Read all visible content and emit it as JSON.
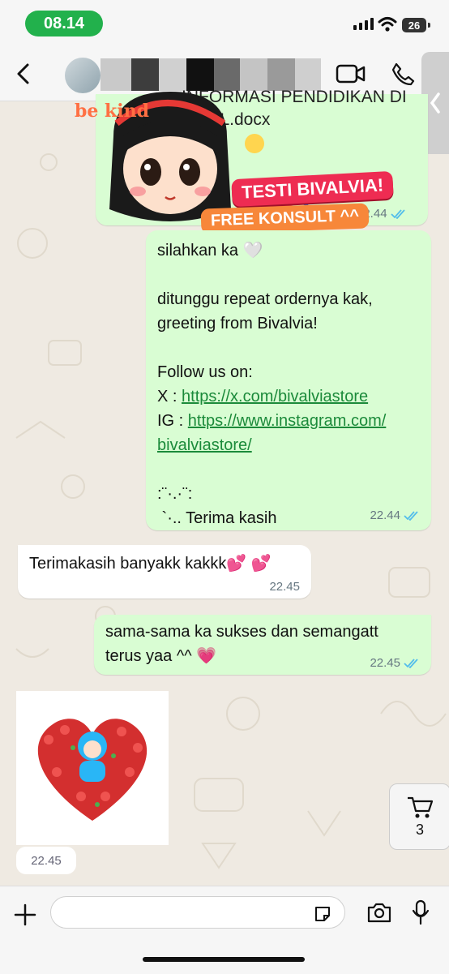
{
  "status_bar": {
    "time": "08.14",
    "battery": "26"
  },
  "header": {
    "back_icon": "chevron-left-icon",
    "video_icon": "video-camera-icon",
    "call_icon": "phone-icon"
  },
  "document": {
    "filename_line1": "INFORMASI PENDIDIKAN DI",
    "filename_line2": "GITAL.docx",
    "time": "22.44"
  },
  "sticker": {
    "brand": "be kind",
    "tag_1": "TESTI BIVALVIA!",
    "tag_2": "FREE KONSULT ^^"
  },
  "messages": [
    {
      "direction": "out",
      "lines": [
        "silahkan ka 🤍",
        "",
        "ditunggu repeat ordernya kak,",
        "greeting from Bivalvia!",
        "",
        "Follow us on:"
      ],
      "x_prefix": "X : ",
      "x_link": "https://x.com/bivalviastore",
      "ig_prefix": "IG : ",
      "ig_link_1": "https://www.instagram.com/",
      "ig_link_2": "bivalviastore/",
      "closing_1": ":¨·.·¨:",
      "closing_2": " `·.. Terima kasih",
      "time": "22.44"
    },
    {
      "direction": "in",
      "text": "Terimakasih banyakk kakkk💕 💕",
      "time": "22.45"
    },
    {
      "direction": "out",
      "line_1": "sama-sama ka sukses dan semangatt",
      "line_2": "terus yaa ^^ 💗",
      "time": "22.45"
    },
    {
      "direction": "in",
      "type": "image",
      "time": "22.45"
    }
  ],
  "cart": {
    "count": "3",
    "icon": "cart-icon"
  },
  "composer": {
    "placeholder": "",
    "plus_icon": "plus-icon",
    "sticker_icon": "sticker-icon",
    "camera_icon": "camera-icon",
    "mic_icon": "microphone-icon"
  },
  "colors": {
    "outgoing": "#d9fdd3",
    "incoming": "#ffffff",
    "link": "#1b8a3a",
    "read_ticks": "#53bdeb"
  }
}
